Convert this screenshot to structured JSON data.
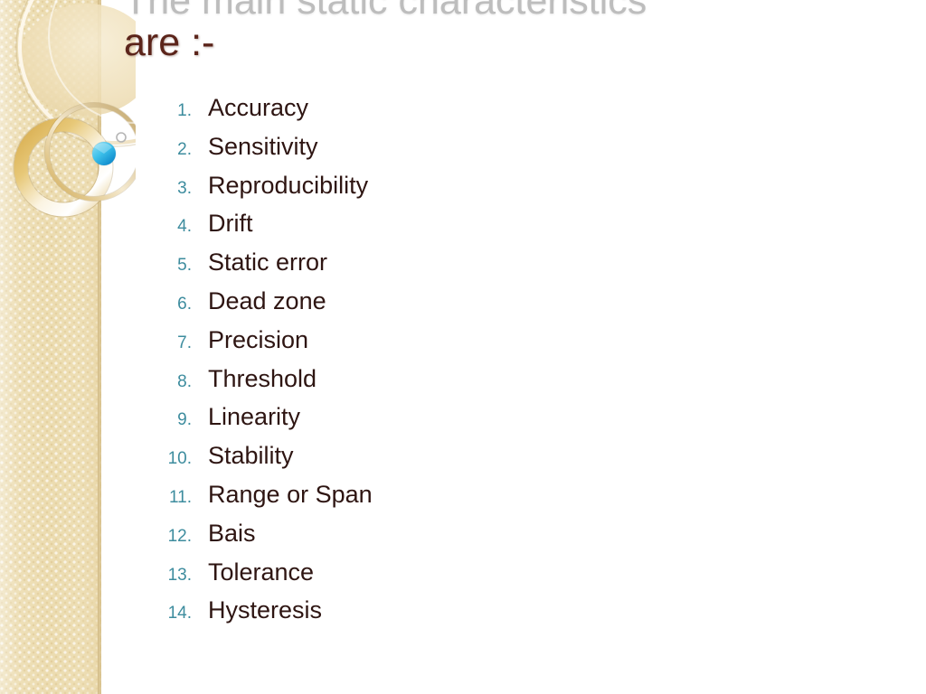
{
  "slide": {
    "background_color": "#ffffff",
    "title": {
      "line1": "The main static characteristics",
      "line2": "are :-",
      "line1_color": "#bdbdbd",
      "line2_color": "#5b241a"
    },
    "list": {
      "number_color": "#3d8c9e",
      "text_color": "#2e1512",
      "items": [
        {
          "number": "1.",
          "label": "Accuracy"
        },
        {
          "number": "2.",
          "label": "Sensitivity"
        },
        {
          "number": "3.",
          "label": "Reproducibility"
        },
        {
          "number": "4.",
          "label": "Drift"
        },
        {
          "number": "5.",
          "label": "Static error"
        },
        {
          "number": "6.",
          "label": "Dead zone"
        },
        {
          "number": "7.",
          "label": "Precision"
        },
        {
          "number": "8.",
          "label": "Threshold"
        },
        {
          "number": "9.",
          "label": "Linearity"
        },
        {
          "number": "10.",
          "label": "Stability"
        },
        {
          "number": "11.",
          "label": "Range or Span"
        },
        {
          "number": "12.",
          "label": "Bais"
        },
        {
          "number": "13.",
          "label": "Tolerance"
        },
        {
          "number": "14.",
          "label": "Hysteresis"
        }
      ]
    },
    "sidebar": {
      "base_color": "#ecdcb0",
      "accent_gold": "#d4a843",
      "accent_cream": "#fbf4e2",
      "dot_color": "#2bb3e0",
      "ring_outline_color": "#b5b5b5"
    }
  }
}
